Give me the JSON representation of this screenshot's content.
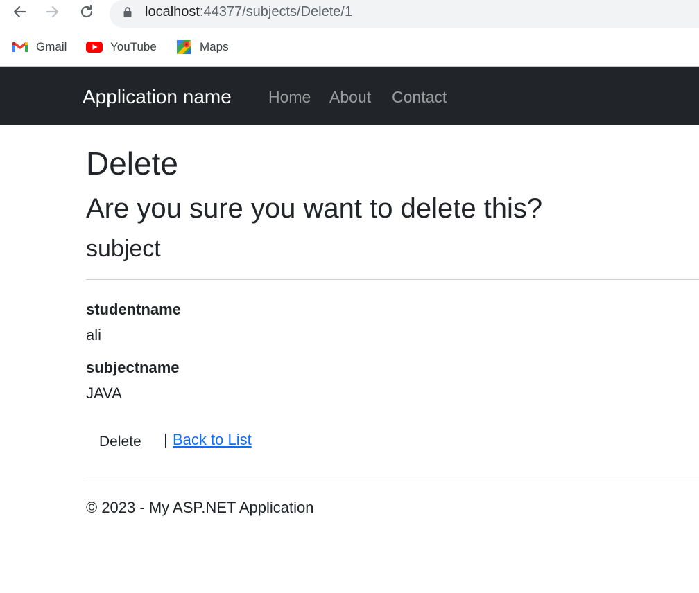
{
  "browser": {
    "url_host": "localhost",
    "url_path": ":44377/subjects/Delete/1",
    "icons": {
      "back": "back-arrow-icon",
      "forward": "forward-arrow-icon",
      "reload": "reload-icon",
      "lock": "lock-icon"
    },
    "bookmarks": [
      {
        "label": "Gmail",
        "icon": "gmail-icon"
      },
      {
        "label": "YouTube",
        "icon": "youtube-icon"
      },
      {
        "label": "Maps",
        "icon": "maps-icon"
      }
    ]
  },
  "navbar": {
    "brand": "Application name",
    "links": [
      "Home",
      "About",
      "Contact"
    ],
    "background": "#212529"
  },
  "page": {
    "title": "Delete",
    "confirm": "Are you sure you want to delete this?",
    "entity": "subject",
    "fields": [
      {
        "label": "studentname",
        "value": "ali"
      },
      {
        "label": "subjectname",
        "value": "JAVA"
      }
    ],
    "delete_button": "Delete",
    "separator": "|",
    "back_link": "Back to List"
  },
  "footer": {
    "text": "© 2023 - My ASP.NET Application"
  },
  "colors": {
    "link": "#0d6efd",
    "text": "#212529"
  }
}
